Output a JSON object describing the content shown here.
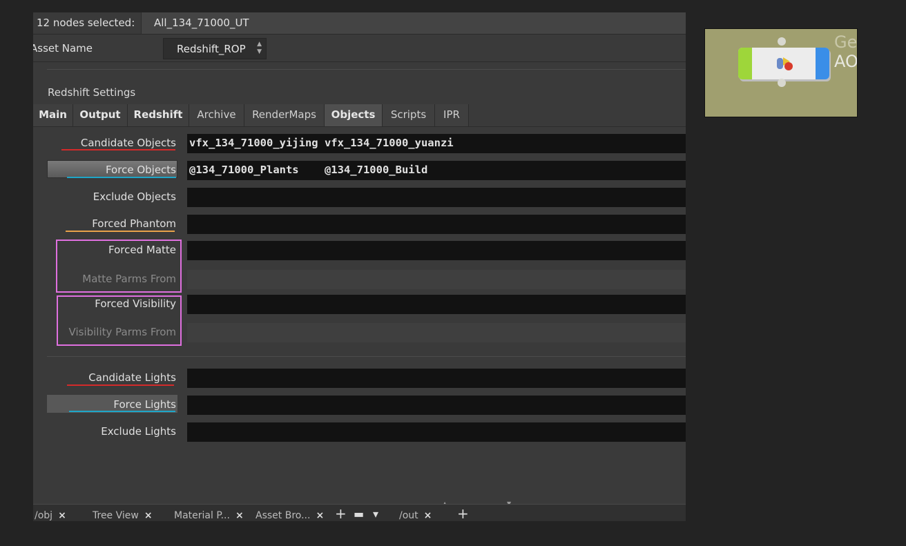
{
  "header": {
    "selection_label": "12 nodes selected:",
    "selection_value": "All_134_71000_UT"
  },
  "asset": {
    "label": "Asset Name",
    "value": "Redshift_ROP",
    "arrows": "▲\n▼"
  },
  "section_title": "Redshift Settings",
  "tabs": [
    {
      "label": "Main",
      "bold": true
    },
    {
      "label": "Output",
      "bold": true
    },
    {
      "label": "Redshift",
      "bold": true
    },
    {
      "label": "Archive",
      "bold": false
    },
    {
      "label": "RenderMaps",
      "bold": false
    },
    {
      "label": "Objects",
      "bold": true,
      "active": true
    },
    {
      "label": "Scripts",
      "bold": false
    },
    {
      "label": "IPR",
      "bold": false
    }
  ],
  "params": {
    "candidate_objects": {
      "label": "Candidate Objects",
      "value": "vfx_134_71000_yijing vfx_134_71000_yuanzi"
    },
    "force_objects": {
      "label": "Force Objects",
      "value": "@134_71000_Plants    @134_71000_Build"
    },
    "exclude_objects": {
      "label": "Exclude Objects",
      "value": ""
    },
    "forced_phantom": {
      "label": "Forced Phantom",
      "value": ""
    },
    "forced_matte": {
      "label": "Forced Matte",
      "value": ""
    },
    "matte_parms_from": {
      "label": "Matte Parms From",
      "value": ""
    },
    "forced_visibility": {
      "label": "Forced Visibility",
      "value": ""
    },
    "visibility_parms_from": {
      "label": "Visibility Parms From",
      "value": ""
    },
    "candidate_lights": {
      "label": "Candidate Lights",
      "value": ""
    },
    "force_lights": {
      "label": "Force Lights",
      "value": ""
    },
    "exclude_lights": {
      "label": "Exclude Lights",
      "value": ""
    }
  },
  "bottom_tabs": [
    {
      "label": "/obj",
      "close": "×"
    },
    {
      "label": "Tree View",
      "close": "×"
    },
    {
      "label": "Material P...",
      "close": "×"
    },
    {
      "label": "Asset Bro...",
      "close": "×"
    },
    {
      "label": "/out",
      "close": "×"
    }
  ],
  "bottom_icons": {
    "plus": "+",
    "panel": "▬",
    "caret": "▾",
    "plus2": "+"
  },
  "thumbnail": {
    "text_top": "Ge",
    "text_bottom": "AO"
  },
  "colors": {
    "underline_red": "#d42a2a",
    "underline_blue": "#1ea6c8",
    "underline_orange": "#e8a24a",
    "highlight_box": "#e070e0",
    "node_green": "#9ed63a",
    "node_blue": "#3a8ee8",
    "thumb_bg": "#a09f6f"
  }
}
